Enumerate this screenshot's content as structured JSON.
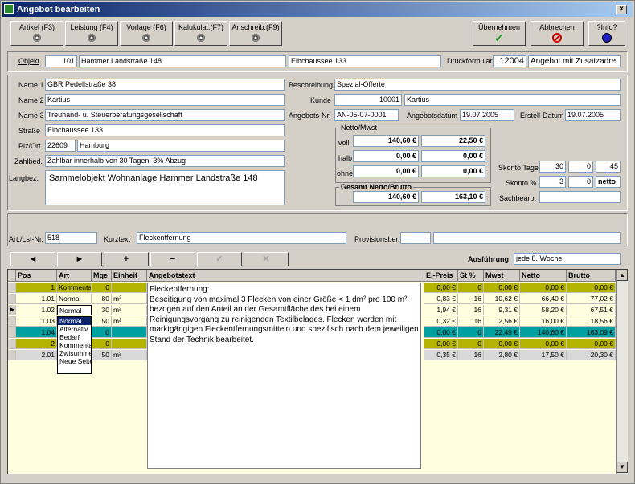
{
  "window": {
    "title": "Angebot bearbeiten",
    "close": "×"
  },
  "toolbar": {
    "buttons": [
      "Artikel (F3)",
      "Leistung (F4)",
      "Vorlage (F6)",
      "Kalukulat.(F7)",
      "Anschreib.(F9)"
    ],
    "ok": "Übernehmen",
    "cancel": "Abbrechen",
    "info": "?Info?"
  },
  "header": {
    "objekt_label": "Objekt",
    "objekt_nr": "101",
    "objekt_name": "Hammer Landstraße 148",
    "objekt_addr": "Elbchaussee 133",
    "druck_label": "Druckformular",
    "druck_nr": "12004",
    "druck_name": "Angebot mit Zusatzadre"
  },
  "address": {
    "name1_label": "Name 1",
    "name1": "GBR Pedellstraße 38",
    "name2_label": "Name 2",
    "name2": "Kartius",
    "name3_label": "Name 3",
    "name3": "Treuhand- u. Steuerberatungsgesellschaft",
    "street_label": "Straße",
    "street": "Elbchaussee 133",
    "plz_label": "Plz/Ort",
    "plz": "22609",
    "ort": "Hamburg",
    "zahl_label": "Zahlbed.",
    "zahl": "Zahlbar innerhalb von 30 Tagen, 3% Abzug",
    "lang_label": "Langbez.",
    "lang": "Sammelobjekt Wohnanlage Hammer Landstraße 148"
  },
  "offer": {
    "beschr_label": "Beschreibung",
    "beschr": "Spezial-Offerte",
    "kunde_label": "Kunde",
    "kunde_nr": "10001",
    "kunde_name": "Kartius",
    "angnr_label": "Angebots-Nr.",
    "angnr": "AN-05-07-0001",
    "angdat_label": "Angebotsdatum",
    "angdat": "19.07.2005",
    "erstdat_label": "Erstell-Datum",
    "erstdat": "19.07.2005"
  },
  "netto": {
    "title": "Netto/Mwst",
    "voll_label": "voll",
    "voll_net": "140,60 €",
    "voll_mwst": "22,50 €",
    "halb_label": "halb",
    "halb_net": "0,00 €",
    "halb_mwst": "0,00 €",
    "ohne_label": "ohne",
    "ohne_net": "0,00 €",
    "ohne_mwst": "0,00 €",
    "gesamt_title": "Gesamt Netto/Brutto",
    "gesamt_net": "140,60 €",
    "gesamt_brutto": "163,10 €"
  },
  "skonto": {
    "tage_label": "Skonto Tage",
    "tage1": "30",
    "tage2": "0",
    "tage3": "45",
    "proz_label": "Skonto %",
    "proz1": "3",
    "proz2": "0",
    "proz3": "netto",
    "sach_label": "Sachbearb.",
    "sach": ""
  },
  "article": {
    "nr_label": "Art./Lst-Nr.",
    "nr": "518",
    "kurz_label": "Kurztext",
    "kurz": "Fleckentfernung",
    "prov_label": "Provisionsber.",
    "prov": ""
  },
  "nav": {
    "prev": "◄",
    "next": "►",
    "add": "+",
    "del": "−",
    "ok": "✓",
    "cancel": "✕",
    "ausf_label": "Ausführung",
    "ausf": "jede 8. Woche"
  },
  "grid": {
    "headers": [
      "Pos",
      "Art",
      "Mge",
      "Einheit",
      "Angebotstext",
      "E.-Preis",
      "St %",
      "Mwst",
      "Netto",
      "Brutto"
    ],
    "rows": [
      {
        "pos": "1",
        "art": "Kommentar",
        "mge": "0",
        "einheit": "",
        "preis": "0,00 €",
        "st": "0",
        "mwst": "0,00 €",
        "netto": "0,00 €",
        "brutto": "0,00 €",
        "style": "olive"
      },
      {
        "pos": "1.01",
        "art": "Normal",
        "mge": "80",
        "einheit": "m²",
        "preis": "0,83 €",
        "st": "16",
        "mwst": "10,62 €",
        "netto": "66,40 €",
        "brutto": "77,02 €",
        "style": "plain"
      },
      {
        "pos": "1.02",
        "art": "Normal",
        "mge": "30",
        "einheit": "m²",
        "preis": "1,94 €",
        "st": "16",
        "mwst": "9,31 €",
        "netto": "58,20 €",
        "brutto": "67,51 €",
        "style": "plain"
      },
      {
        "pos": "1.03",
        "art": "",
        "mge": "50",
        "einheit": "m²",
        "preis": "0,32 €",
        "st": "16",
        "mwst": "2,56 €",
        "netto": "16,00 €",
        "brutto": "18,56 €",
        "style": "plain"
      },
      {
        "pos": "1.04",
        "art": "",
        "mge": "0",
        "einheit": "",
        "preis": "0,00 €",
        "st": "0",
        "mwst": "22,49 €",
        "netto": "140,60 €",
        "brutto": "163,09 €",
        "style": "teal"
      },
      {
        "pos": "2",
        "art": "",
        "mge": "0",
        "einheit": "",
        "preis": "0,00 €",
        "st": "0",
        "mwst": "0,00 €",
        "netto": "0,00 €",
        "brutto": "0,00 €",
        "style": "olive"
      },
      {
        "pos": "2.01",
        "art": "",
        "mge": "50",
        "einheit": "m²",
        "preis": "0,35 €",
        "st": "16",
        "mwst": "2,80 €",
        "netto": "17,50 €",
        "brutto": "20,30 €",
        "style": "grey"
      }
    ],
    "dropdown": [
      "Normal",
      "Alternativ",
      "Bedarf",
      "Kommentar",
      "Zwisumme",
      "Neue Seite"
    ],
    "text": "Fleckentfernung:\nBeseitigung von maximal 3 Flecken von einer Größe < 1 dm² pro 100 m² bezogen auf den Anteil an der Gesamtfläche des bei einem Reinigungsvorgang zu reinigenden Textilbelages. Flecken werden mit marktgängigen Fleckentfernungsmitteln und spezifisch nach dem jeweiligen Stand der Technik bearbeitet."
  },
  "colors": {
    "olive": "#b4b400",
    "teal": "#00a0a0",
    "grey": "#d8d8d8"
  }
}
